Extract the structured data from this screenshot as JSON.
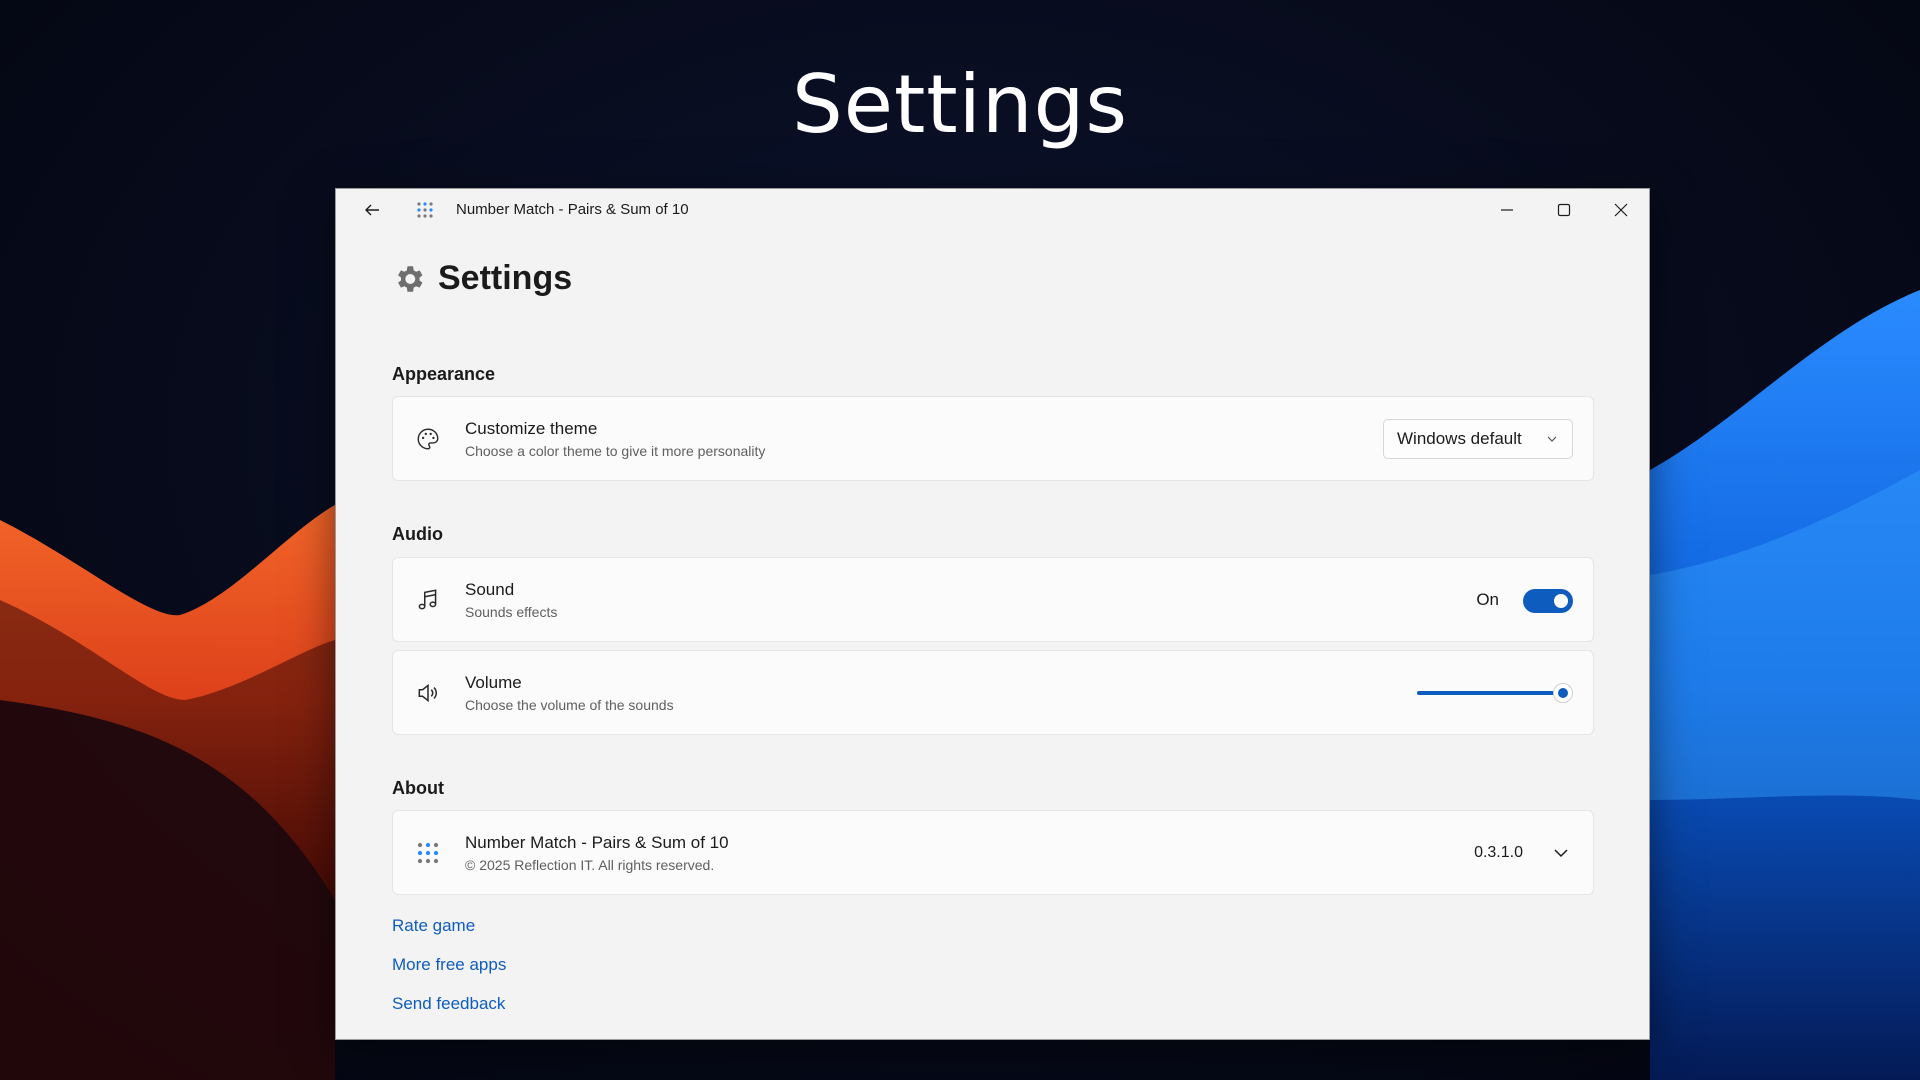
{
  "hero": {
    "title": "Settings"
  },
  "window": {
    "title": "Number Match - Pairs & Sum of 10",
    "icons": {
      "back": "back-arrow-icon",
      "app": "app-logo-icon",
      "minimize": "minimize-icon",
      "maximize": "maximize-icon",
      "close": "close-icon"
    }
  },
  "page": {
    "title": "Settings",
    "icon": "gear-icon"
  },
  "appearance": {
    "label": "Appearance",
    "theme": {
      "title": "Customize theme",
      "subtitle": "Choose a color theme to give it more personality",
      "icon": "palette-icon",
      "selected": "Windows default"
    }
  },
  "audio": {
    "label": "Audio",
    "sound": {
      "title": "Sound",
      "subtitle": "Sounds effects",
      "icon": "music-note-icon",
      "state_label": "On",
      "enabled": true
    },
    "volume": {
      "title": "Volume",
      "subtitle": "Choose the volume of the sounds",
      "icon": "speaker-icon",
      "level": 1.0
    }
  },
  "about": {
    "label": "About",
    "app": {
      "title": "Number Match - Pairs & Sum of 10",
      "subtitle": "© 2025 Reflection IT. All rights reserved.",
      "icon": "app-logo-icon",
      "version": "0.3.1.0"
    }
  },
  "links": {
    "rate": "Rate game",
    "more_apps": "More free apps",
    "feedback": "Send feedback"
  },
  "colors": {
    "accent": "#0f5cbf",
    "window_bg": "#f3f3f3",
    "card_bg": "#fbfbfb"
  }
}
